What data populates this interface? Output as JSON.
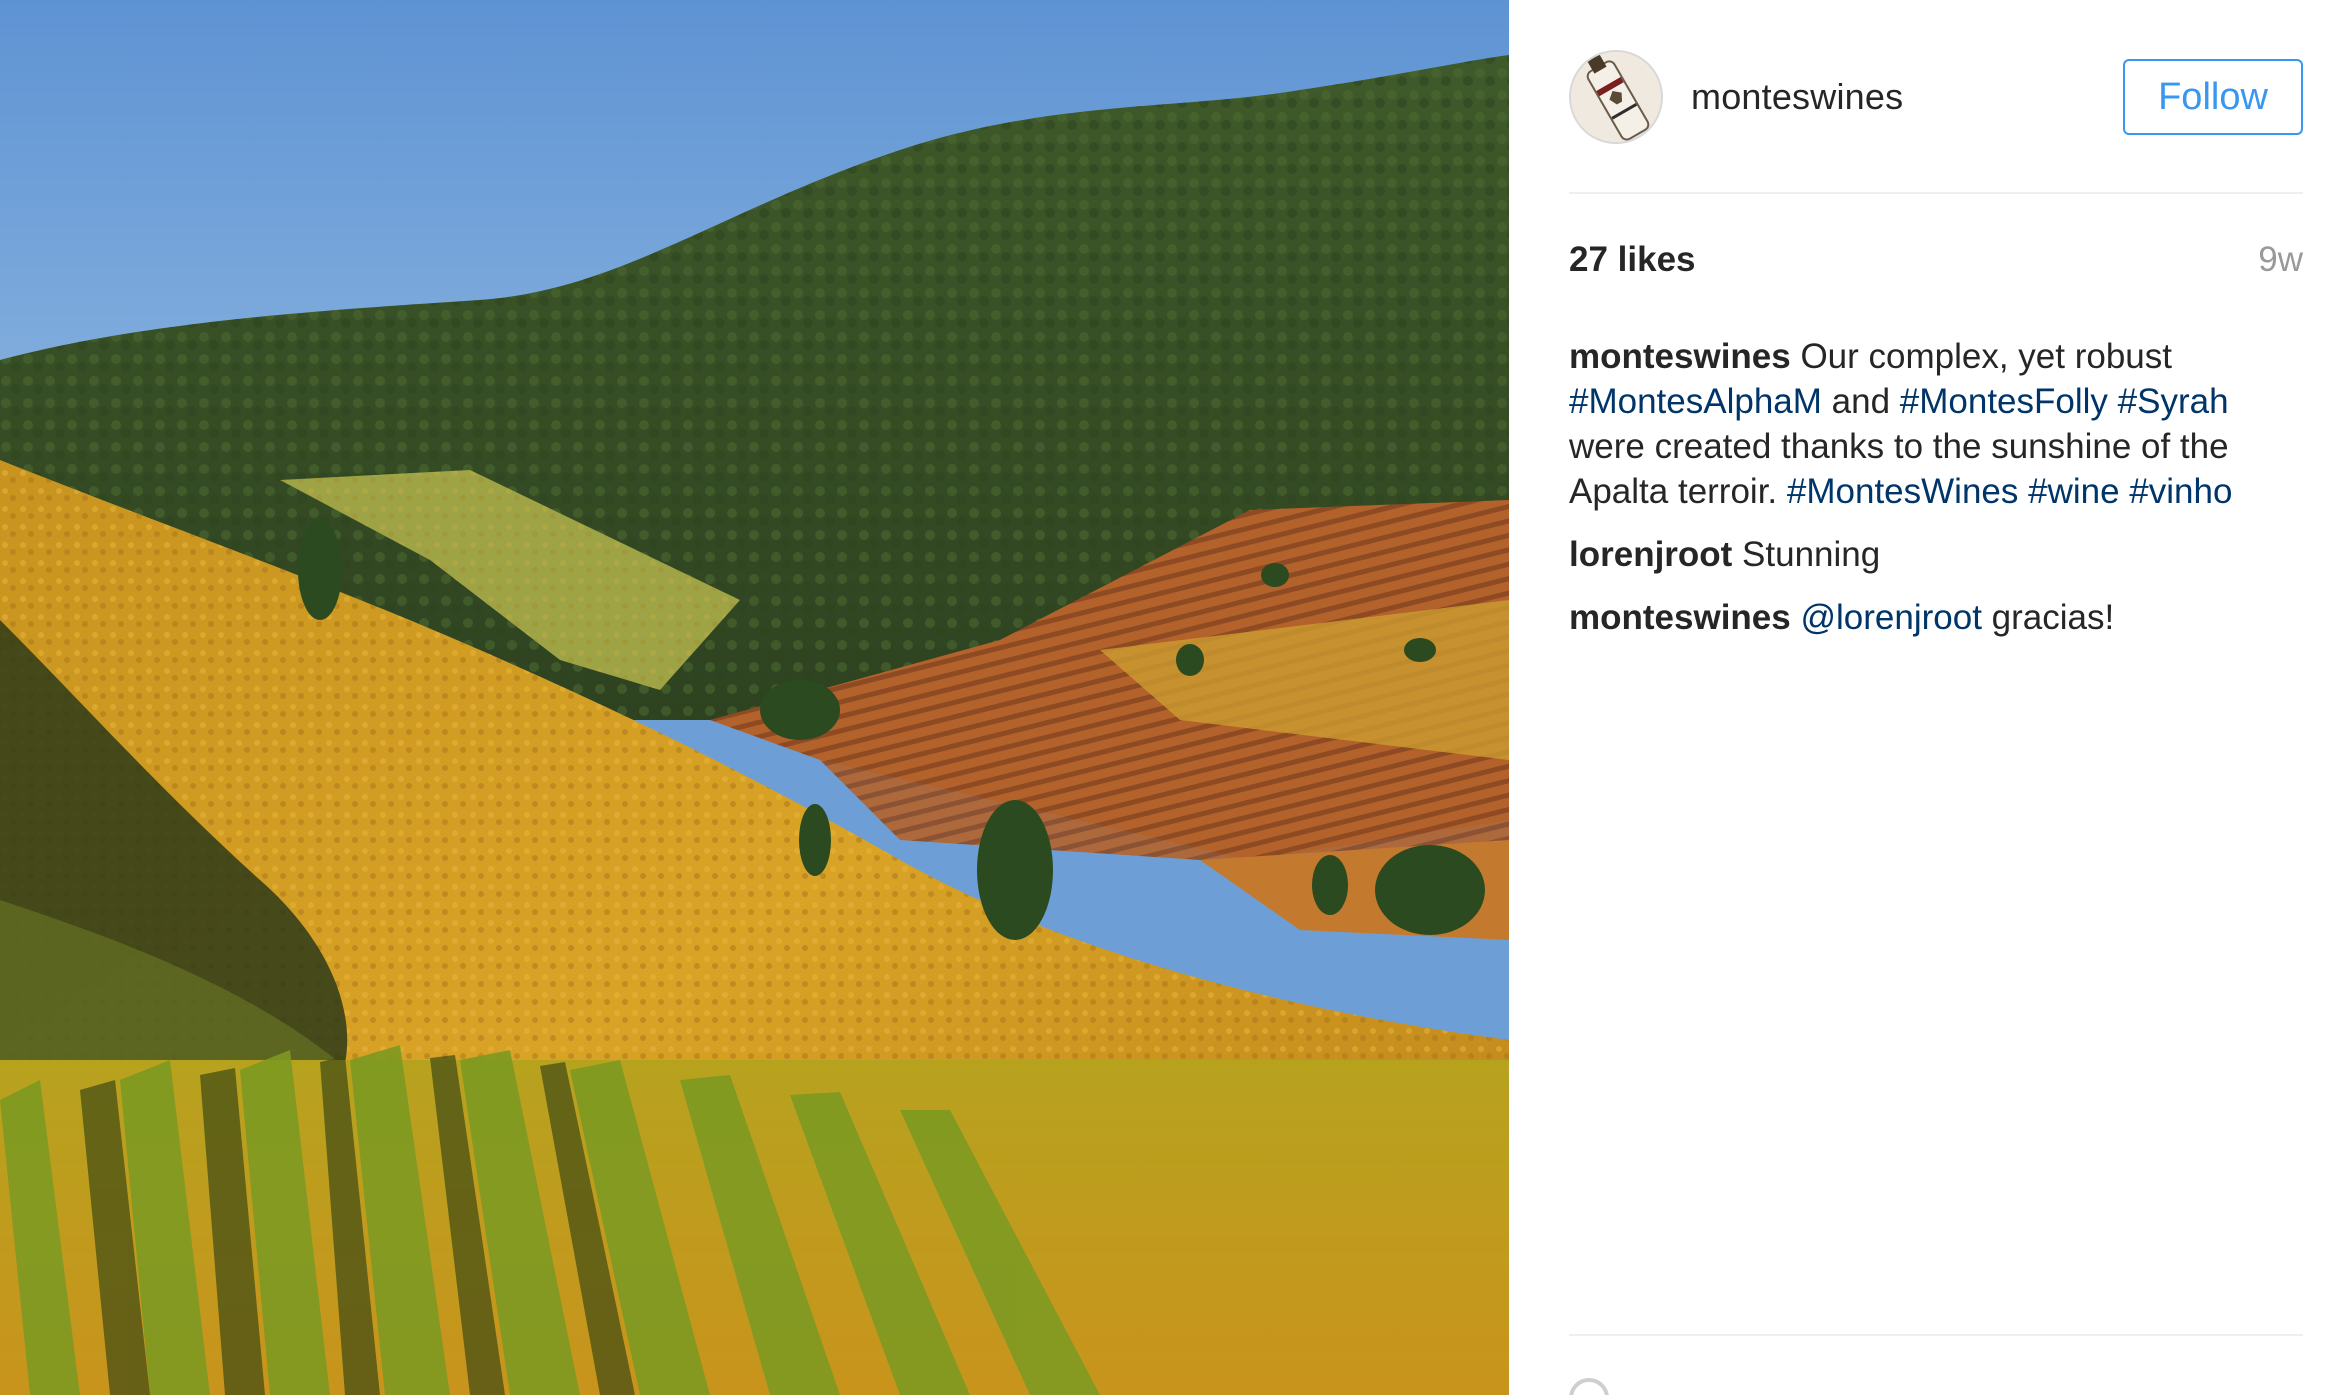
{
  "post": {
    "username": "monteswines",
    "follow_label": "Follow",
    "likes_text": "27 likes",
    "time_ago": "9w",
    "avatar_icon": "wine-bottle-logo-icon"
  },
  "comments": [
    {
      "author": "monteswines",
      "segments": [
        {
          "text": " Our complex, yet robust ",
          "type": "text"
        },
        {
          "text": "#MontesAlphaM",
          "type": "tag"
        },
        {
          "text": " and ",
          "type": "text"
        },
        {
          "text": "#MontesFolly",
          "type": "tag"
        },
        {
          "text": " ",
          "type": "text"
        },
        {
          "text": "#Syrah",
          "type": "tag"
        },
        {
          "text": " were created thanks to the sunshine of the Apalta terroir. ",
          "type": "text"
        },
        {
          "text": "#MontesWines",
          "type": "tag"
        },
        {
          "text": " ",
          "type": "text"
        },
        {
          "text": "#wine",
          "type": "tag"
        },
        {
          "text": " ",
          "type": "text"
        },
        {
          "text": "#vinho",
          "type": "tag"
        }
      ]
    },
    {
      "author": "lorenjroot",
      "segments": [
        {
          "text": " Stunning",
          "type": "text"
        }
      ]
    },
    {
      "author": "monteswines",
      "segments": [
        {
          "text": " ",
          "type": "text"
        },
        {
          "text": "@lorenjroot",
          "type": "tag"
        },
        {
          "text": " gracias!",
          "type": "text"
        }
      ]
    }
  ],
  "colors": {
    "follow_blue": "#3897f0",
    "link_blue": "#003569",
    "text": "#262626",
    "muted": "#999999"
  }
}
